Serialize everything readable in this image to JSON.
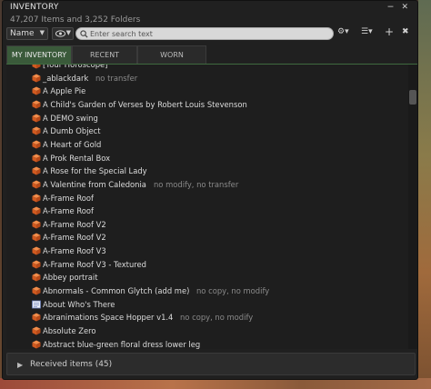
{
  "window": {
    "title": "INVENTORY",
    "summary": "47,207 Items and 3,252 Folders",
    "minimize_glyph": "‒",
    "close_glyph": "✕"
  },
  "toolbar": {
    "sort_value": "Name",
    "search_placeholder": "Enter search text",
    "gear_glyph": "⚙▾",
    "view_glyph": "☰▾",
    "add_glyph": "+",
    "trash_glyph": "✖"
  },
  "tabs": [
    {
      "label": "MY INVENTORY",
      "active": true
    },
    {
      "label": "RECENT",
      "active": false
    },
    {
      "label": "WORN",
      "active": false
    }
  ],
  "items": [
    {
      "name": "[Your Horoscope]",
      "perm": "",
      "icon": "object"
    },
    {
      "name": "_ablackdark",
      "perm": "no transfer",
      "icon": "object"
    },
    {
      "name": "A Apple Pie",
      "perm": "",
      "icon": "object"
    },
    {
      "name": "A Child's Garden of Verses by Robert Louis Stevenson",
      "perm": "",
      "icon": "object"
    },
    {
      "name": "A DEMO swing",
      "perm": "",
      "icon": "object"
    },
    {
      "name": "A Dumb Object",
      "perm": "",
      "icon": "object"
    },
    {
      "name": "A Heart of Gold",
      "perm": "",
      "icon": "object"
    },
    {
      "name": "A Prok Rental Box",
      "perm": "",
      "icon": "object"
    },
    {
      "name": "A Rose for the Special Lady",
      "perm": "",
      "icon": "object"
    },
    {
      "name": "A Valentine from Caledonia",
      "perm": "no modify, no transfer",
      "icon": "object"
    },
    {
      "name": "A-Frame Roof",
      "perm": "",
      "icon": "object"
    },
    {
      "name": "A-Frame Roof",
      "perm": "",
      "icon": "object"
    },
    {
      "name": "A-Frame Roof V2",
      "perm": "",
      "icon": "object"
    },
    {
      "name": "A-Frame Roof V2",
      "perm": "",
      "icon": "object"
    },
    {
      "name": "A-Frame Roof V3",
      "perm": "",
      "icon": "object"
    },
    {
      "name": "A-Frame Roof V3 - Textured",
      "perm": "",
      "icon": "object"
    },
    {
      "name": "Abbey portrait",
      "perm": "",
      "icon": "object"
    },
    {
      "name": "Abnormals - Common Glytch (add me)",
      "perm": "no copy, no modify",
      "icon": "object"
    },
    {
      "name": "About Who's There",
      "perm": "",
      "icon": "notecard"
    },
    {
      "name": "Abranimations Space Hopper v1.4",
      "perm": "no copy, no modify",
      "icon": "object"
    },
    {
      "name": "Absolute Zero",
      "perm": "",
      "icon": "object"
    },
    {
      "name": "Abstract blue-green floral dress lower leg",
      "perm": "",
      "icon": "object"
    }
  ],
  "received": {
    "label": "Received items (45)"
  },
  "colors": {
    "object_icon": "#e0692a",
    "active_tab": "#3a5a3a"
  }
}
